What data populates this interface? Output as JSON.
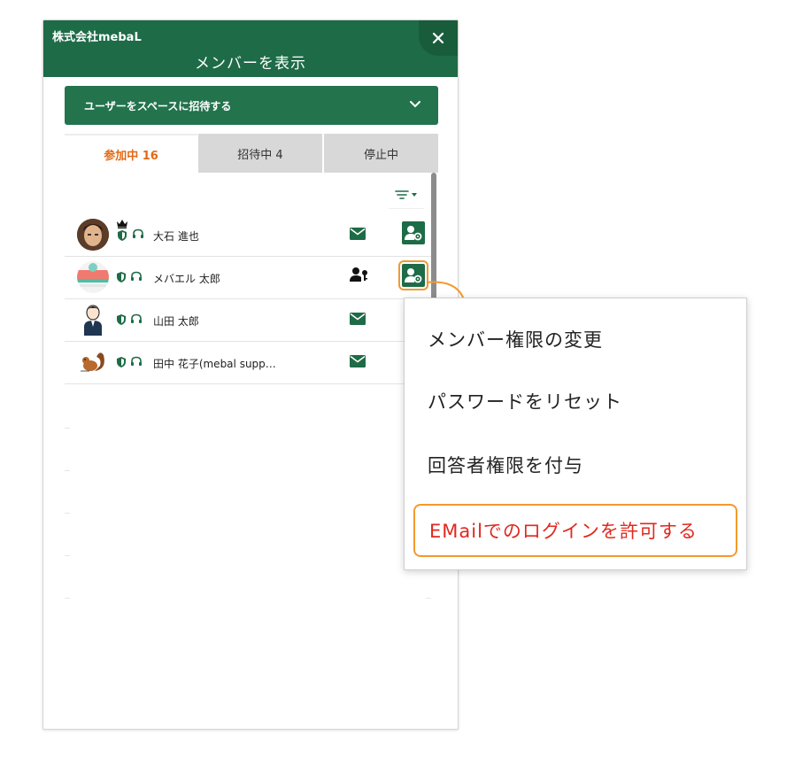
{
  "header": {
    "org_name": "株式会社mebaL",
    "title": "メンバーを表示"
  },
  "invite": {
    "label": "ユーザーをスペースに招待する"
  },
  "tabs": [
    {
      "label": "参加中 16",
      "active": true
    },
    {
      "label": "招待中 4",
      "active": false
    },
    {
      "label": "停止中",
      "active": false
    }
  ],
  "members": [
    {
      "name": "大石 進也",
      "badges": [
        "crown-icon",
        "shield-icon",
        "headset-icon"
      ],
      "status_icon": "mail-icon"
    },
    {
      "name": "メバエル 太郎",
      "badges": [
        "shield-icon",
        "headset-icon"
      ],
      "status_icon": "user-key-icon"
    },
    {
      "name": "山田 太郎",
      "badges": [
        "shield-icon",
        "headset-icon"
      ],
      "status_icon": "mail-icon"
    },
    {
      "name": "田中 花子(mebal supp…",
      "badges": [
        "shield-icon",
        "headset-icon"
      ],
      "status_icon": "mail-icon"
    }
  ],
  "context_menu": {
    "items": [
      {
        "label": "メンバー権限の変更"
      },
      {
        "label": "パスワードをリセット"
      },
      {
        "label": "回答者権限を付与"
      },
      {
        "label": "EMailでのログインを許可する",
        "highlighted": true
      }
    ]
  },
  "colors": {
    "primary_green": "#1e6b47",
    "active_tab": "#e26a14",
    "highlight_orange": "#f29a2e",
    "danger_red": "#e0281e"
  }
}
